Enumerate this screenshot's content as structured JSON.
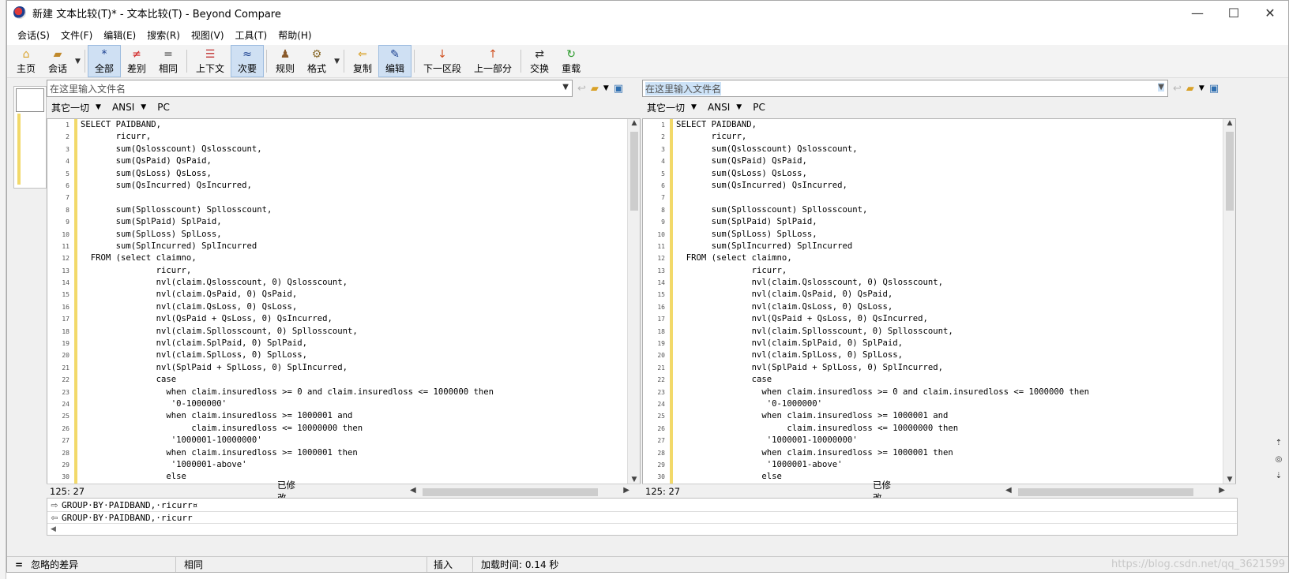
{
  "window": {
    "title": "新建 文本比较(T)* - 文本比较(T) - Beyond Compare",
    "minimize_glyph": "—",
    "maximize_glyph": "☐",
    "close_glyph": "✕"
  },
  "menu": [
    "会话(S)",
    "文件(F)",
    "编辑(E)",
    "搜索(R)",
    "视图(V)",
    "工具(T)",
    "帮助(H)"
  ],
  "toolbar": [
    {
      "label": "主页",
      "icon": "home-icon",
      "glyph": "⌂",
      "color": "#d9a128"
    },
    {
      "label": "会话",
      "icon": "session-icon",
      "glyph": "▰",
      "color": "#c0892b",
      "dropdown": true
    },
    {
      "label": "全部",
      "icon": "all-icon",
      "glyph": "*",
      "color": "#1a3f8f",
      "active": true
    },
    {
      "label": "差别",
      "icon": "diff-icon",
      "glyph": "≠",
      "color": "#d02020"
    },
    {
      "label": "相同",
      "icon": "same-icon",
      "glyph": "=",
      "color": "#333333"
    },
    {
      "label": "上下文",
      "icon": "context-icon",
      "glyph": "☰",
      "color": "#c03030"
    },
    {
      "label": "次要",
      "icon": "minor-icon",
      "glyph": "≈",
      "color": "#1a3f8f",
      "active": true
    },
    {
      "label": "规则",
      "icon": "rules-icon",
      "glyph": "♟",
      "color": "#8a5a2b"
    },
    {
      "label": "格式",
      "icon": "format-icon",
      "glyph": "⚙",
      "color": "#8a6a2b",
      "dropdown": true
    },
    {
      "label": "复制",
      "icon": "copy-icon",
      "glyph": "⇐",
      "color": "#d9a128"
    },
    {
      "label": "编辑",
      "icon": "edit-icon",
      "glyph": "✎",
      "color": "#1a3f8f",
      "active": true
    },
    {
      "label": "下一区段",
      "icon": "next-section-icon",
      "glyph": "↓",
      "color": "#d05020"
    },
    {
      "label": "上一部分",
      "icon": "prev-section-icon",
      "glyph": "↑",
      "color": "#d05020"
    },
    {
      "label": "交换",
      "icon": "swap-icon",
      "glyph": "⇄",
      "color": "#333333"
    },
    {
      "label": "重载",
      "icon": "reload-icon",
      "glyph": "↻",
      "color": "#2a9a2a"
    }
  ],
  "left_pane": {
    "path_placeholder": "在这里输入文件名",
    "encoding": [
      "其它一切",
      "ANSI",
      "PC"
    ],
    "cursor_pos": "125: 27",
    "state": "已修改"
  },
  "right_pane": {
    "path_placeholder": "在这里输入文件名",
    "encoding": [
      "其它一切",
      "ANSI",
      "PC"
    ],
    "cursor_pos": "125: 27",
    "state": "已修改"
  },
  "code_lines": [
    {
      "n": "1",
      "text": "SELECT PAIDBAND,"
    },
    {
      "n": "2",
      "text": "       ricurr,"
    },
    {
      "n": "3",
      "text": "       sum(Qslosscount) Qslosscount,"
    },
    {
      "n": "4",
      "text": "       sum(QsPaid) QsPaid,"
    },
    {
      "n": "5",
      "text": "       sum(QsLoss) QsLoss,"
    },
    {
      "n": "6",
      "text": "       sum(QsIncurred) QsIncurred,"
    },
    {
      "n": "7",
      "text": ""
    },
    {
      "n": "8",
      "text": "       sum(Spllosscount) Spllosscount,"
    },
    {
      "n": "9",
      "text": "       sum(SplPaid) SplPaid,"
    },
    {
      "n": "10",
      "text": "       sum(SplLoss) SplLoss,"
    },
    {
      "n": "11",
      "text": "       sum(SplIncurred) SplIncurred"
    },
    {
      "n": "12",
      "text": "  FROM (select claimno,"
    },
    {
      "n": "13",
      "text": "               ricurr,"
    },
    {
      "n": "14",
      "text": "               nvl(claim.Qslosscount, 0) Qslosscount,"
    },
    {
      "n": "15",
      "text": "               nvl(claim.QsPaid, 0) QsPaid,"
    },
    {
      "n": "16",
      "text": "               nvl(claim.QsLoss, 0) QsLoss,"
    },
    {
      "n": "17",
      "text": "               nvl(QsPaid + QsLoss, 0) QsIncurred,"
    },
    {
      "n": "18",
      "text": "               nvl(claim.Spllosscount, 0) Spllosscount,"
    },
    {
      "n": "19",
      "text": "               nvl(claim.SplPaid, 0) SplPaid,"
    },
    {
      "n": "20",
      "text": "               nvl(claim.SplLoss, 0) SplLoss,"
    },
    {
      "n": "21",
      "text": "               nvl(SplPaid + SplLoss, 0) SplIncurred,"
    },
    {
      "n": "22",
      "text": "               case"
    },
    {
      "n": "23",
      "text": "                 when claim.insuredloss >= 0 and claim.insuredloss <= 1000000 then"
    },
    {
      "n": "24",
      "text": "                  '0-1000000'"
    },
    {
      "n": "25",
      "text": "                 when claim.insuredloss >= 1000001 and"
    },
    {
      "n": "26",
      "text": "                      claim.insuredloss <= 10000000 then"
    },
    {
      "n": "27",
      "text": "                  '1000001-10000000'"
    },
    {
      "n": "28",
      "text": "                 when claim.insuredloss >= 1000001 then"
    },
    {
      "n": "29",
      "text": "                  '1000001-above'"
    },
    {
      "n": "30",
      "text": "                 else"
    }
  ],
  "line_compare": {
    "left_text": "GROUP·BY·PAIDBAND,·ricurr¤",
    "right_text": "GROUP·BY·PAIDBAND,·ricurr"
  },
  "statusbar": {
    "ignore_glyph": "=",
    "ignore_label": "忽略的差异",
    "same_label": "相同",
    "insert_mode": "插入",
    "load_time": "加载时间: 0.14 秒"
  },
  "watermark": "https://blog.csdn.net/qq_3621599"
}
